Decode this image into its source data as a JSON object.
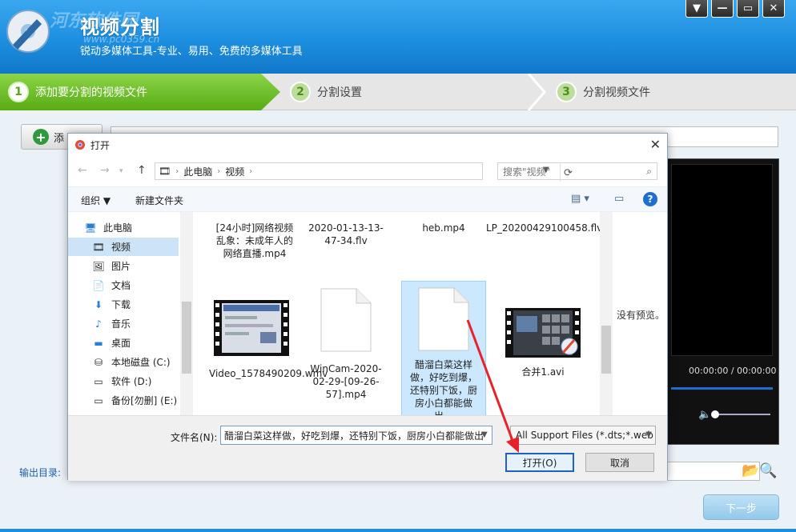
{
  "app": {
    "title": "视频分割",
    "subtitle": "锐动多媒体工具-专业、易用、免费的多媒体工具",
    "watermark_top": "河东软件园",
    "watermark_url": "www.pc0359.cn"
  },
  "window_controls": [
    "▼",
    "—",
    "▭",
    "✕"
  ],
  "steps": [
    {
      "num": "1",
      "label": "添加要分割的视频文件"
    },
    {
      "num": "2",
      "label": "分割设置"
    },
    {
      "num": "3",
      "label": "分割视频文件"
    }
  ],
  "main": {
    "add_label": "添",
    "preview_time": "00:00:00 / 00:00:00",
    "output_label": "输出目录:",
    "next_label": "下一步"
  },
  "dialog": {
    "title": "打开",
    "address": [
      "此电脑",
      "视频"
    ],
    "search_placeholder": "搜索\"视频\"",
    "toolbar": {
      "organize": "组织 ▼",
      "new_folder": "新建文件夹"
    },
    "nav_items": [
      {
        "label": "此电脑",
        "icon": "pc-icon"
      },
      {
        "label": "视频",
        "icon": "video-icon"
      },
      {
        "label": "图片",
        "icon": "picture-icon"
      },
      {
        "label": "文档",
        "icon": "document-icon"
      },
      {
        "label": "下载",
        "icon": "download-icon"
      },
      {
        "label": "音乐",
        "icon": "music-icon"
      },
      {
        "label": "桌面",
        "icon": "desktop-icon"
      },
      {
        "label": "本地磁盘 (C:)",
        "icon": "drive-icon"
      },
      {
        "label": "软件 (D:)",
        "icon": "drive-icon"
      },
      {
        "label": "备份[勿删] (E:)",
        "icon": "drive-icon"
      }
    ],
    "files_row1": [
      {
        "name": "[24小时]网络视频乱象：未成年人的网络直播.mp4"
      },
      {
        "name": "2020-01-13-13-47-34.flv"
      },
      {
        "name": "heb.mp4"
      },
      {
        "name": "LP_20200429100458.flv"
      }
    ],
    "files_row2": [
      {
        "name": "Video_1578490209.wmv"
      },
      {
        "name": "WinCam-2020-02-29-[09-26-57].mp4"
      },
      {
        "name": "醋溜白菜这样做，好吃到爆，还特别下饭，厨房小白都能做出…"
      },
      {
        "name": "合并1.avi"
      }
    ],
    "no_preview": "没有预览。",
    "filename_label": "文件名(N):",
    "filename_value": "醋溜白菜这样做，好吃到爆，还特别下饭，厨房小白都能做出",
    "filter_value": "All Support Files (*.dts;*.web",
    "open_label": "打开(O)",
    "cancel_label": "取消"
  },
  "colors": {
    "header_blue": "#1d8fe0",
    "step_green": "#58ac15",
    "arrow_red": "#e8222a"
  }
}
